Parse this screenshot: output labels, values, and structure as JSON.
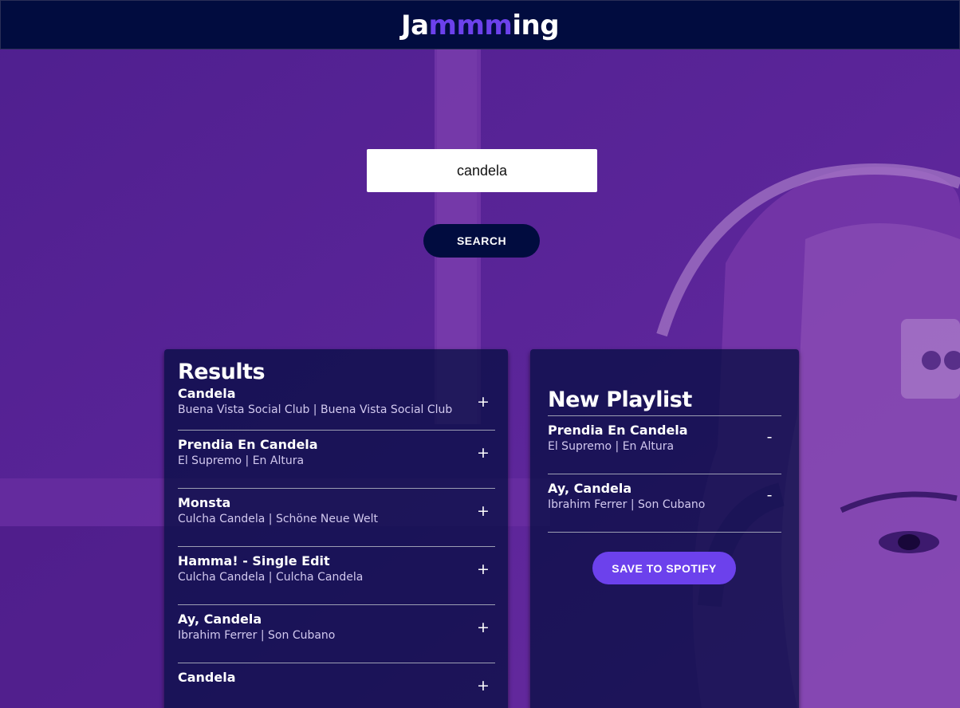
{
  "header": {
    "logo_prefix": "Ja",
    "logo_accent": "mmm",
    "logo_suffix": "ing"
  },
  "search": {
    "value": "candela",
    "button_label": "SEARCH"
  },
  "results": {
    "title": "Results",
    "add_label": "+",
    "tracks": [
      {
        "name": "Candela",
        "meta": "Buena Vista Social Club | Buena Vista Social Club"
      },
      {
        "name": "Prendia En Candela",
        "meta": "El Supremo | En Altura"
      },
      {
        "name": "Monsta",
        "meta": "Culcha Candela | Schöne Neue Welt"
      },
      {
        "name": "Hamma! - Single Edit",
        "meta": "Culcha Candela | Culcha Candela"
      },
      {
        "name": "Ay, Candela",
        "meta": "Ibrahim Ferrer | Son Cubano"
      },
      {
        "name": "Candela",
        "meta": ""
      }
    ]
  },
  "playlist": {
    "name": "New Playlist",
    "remove_label": "-",
    "save_label": "SAVE TO SPOTIFY",
    "tracks": [
      {
        "name": "Prendia En Candela",
        "meta": "El Supremo | En Altura"
      },
      {
        "name": "Ay, Candela",
        "meta": "Ibrahim Ferrer | Son Cubano"
      }
    ]
  },
  "colors": {
    "header_bg": "#010c3f",
    "accent": "#6c41ec",
    "page_bg": "#5a2598"
  }
}
